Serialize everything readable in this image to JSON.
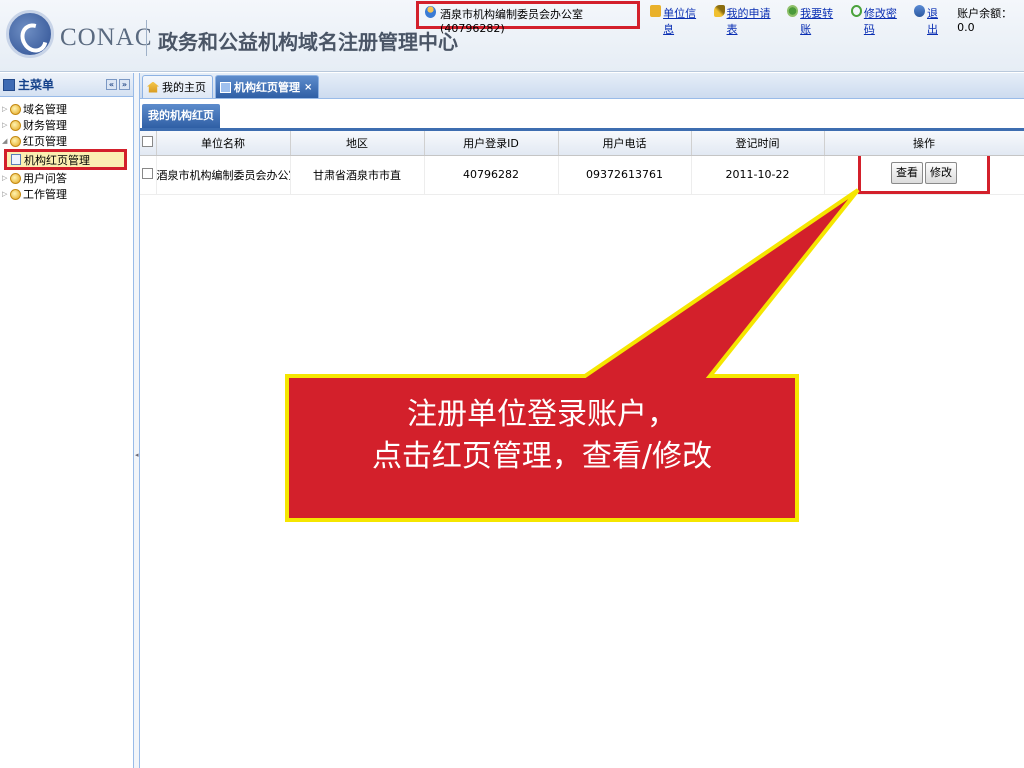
{
  "header": {
    "logo_text": "CONAC",
    "site_title": "政务和公益机构域名注册管理中心",
    "user_label": "酒泉市机构编制委员会办公室(40796282)",
    "links": [
      {
        "label": "单位信息",
        "icon": "info-icon"
      },
      {
        "label": "我的申请表",
        "icon": "key-icon"
      },
      {
        "label": "我要转账",
        "icon": "people-icon"
      },
      {
        "label": "修改密码",
        "icon": "refresh-icon"
      },
      {
        "label": "退出",
        "icon": "exit-icon"
      }
    ],
    "balance": "账户余额：0.0"
  },
  "sidebar": {
    "title": "主菜单",
    "items": [
      {
        "label": "域名管理"
      },
      {
        "label": "财务管理"
      },
      {
        "label": "红页管理",
        "children": [
          {
            "label": "机构红页管理",
            "selected": true
          }
        ]
      },
      {
        "label": "用户问答"
      },
      {
        "label": "工作管理"
      }
    ]
  },
  "tabs": [
    {
      "label": "我的主页",
      "active": false
    },
    {
      "label": "机构红页管理",
      "active": true,
      "close": "×"
    }
  ],
  "panel": {
    "title": "我的机构红页"
  },
  "table": {
    "columns": [
      "单位名称",
      "地区",
      "用户登录ID",
      "用户电话",
      "登记时间",
      "操作"
    ],
    "rows": [
      {
        "name": "酒泉市机构编制委员会办公室",
        "region": "甘肃省酒泉市市直",
        "login_id": "40796282",
        "phone": "09372613761",
        "date": "2011-10-22",
        "actions": [
          "查看",
          "修改"
        ]
      }
    ]
  },
  "callout": {
    "line1": "注册单位登录账户，",
    "line2": "点击红页管理，查看/修改",
    "fill": "#d3202b",
    "border": "#f5e600"
  }
}
